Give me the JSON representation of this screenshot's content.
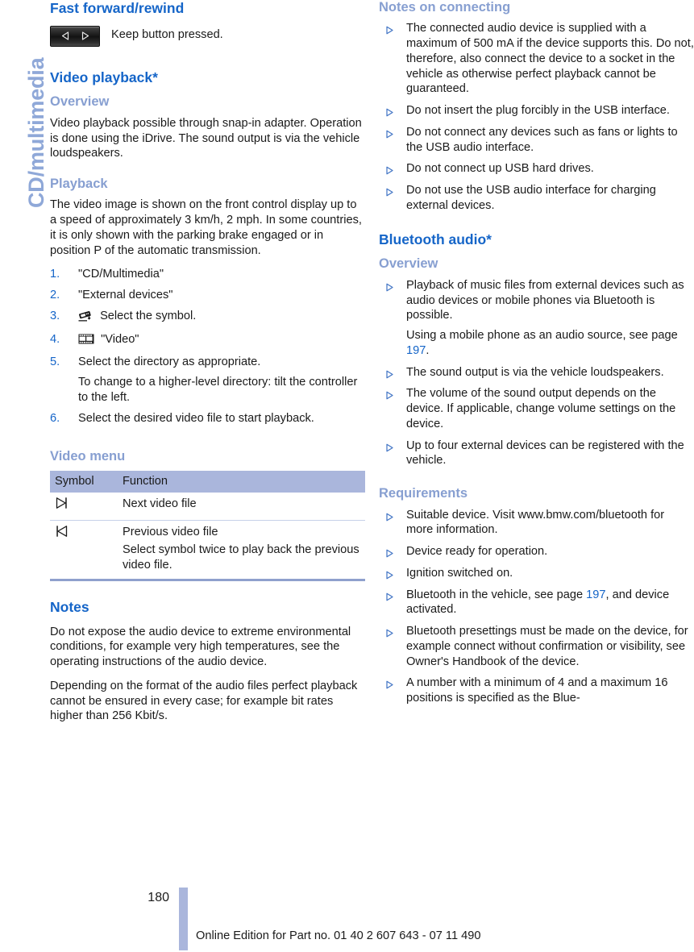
{
  "side_tab": {
    "label": "CD/multimedia"
  },
  "left_column": {
    "fast_forward": {
      "heading": "Fast forward/rewind",
      "button_icon": "seek-back-forward-button",
      "caption": "Keep button pressed."
    },
    "video_playback": {
      "heading": "Video playback*",
      "overview": {
        "heading": "Overview",
        "paragraph": "Video playback possible through snap-in adapter. Operation is done using the iDrive. The sound output is via the vehicle loudspeakers."
      },
      "playback": {
        "heading": "Playback",
        "paragraph": "The video image is shown on the front control display up to a speed of approximately 3 km/h, 2 mph. In some countries, it is only shown with the parking brake engaged or in position P of the automatic transmission.",
        "steps": [
          {
            "num": "1.",
            "icon": null,
            "text": "\"CD/Multimedia\"",
            "note": null
          },
          {
            "num": "2.",
            "icon": null,
            "text": "\"External devices\"",
            "note": null
          },
          {
            "num": "3.",
            "icon": "external-device-icon",
            "text": "Select the symbol.",
            "note": null
          },
          {
            "num": "4.",
            "icon": "filmstrip-icon",
            "text": "\"Video\"",
            "note": null
          },
          {
            "num": "5.",
            "icon": null,
            "text": "Select the directory as appropriate.",
            "note": "To change to a higher-level directory: tilt the controller to the left."
          },
          {
            "num": "6.",
            "icon": null,
            "text": "Select the desired video file to start playback.",
            "note": null
          }
        ]
      },
      "video_menu": {
        "heading": "Video menu",
        "table": {
          "columns": [
            "Symbol",
            "Function"
          ],
          "rows": [
            {
              "symbol_icon": "next-track-icon",
              "function": "Next video file",
              "extra": null
            },
            {
              "symbol_icon": "previous-track-icon",
              "function": "Previous video file",
              "extra": "Select symbol twice to play back the previous video file."
            }
          ]
        }
      }
    },
    "notes": {
      "heading": "Notes",
      "paragraphs": [
        "Do not expose the audio device to extreme environmental conditions, for example very high temperatures, see the operating instructions of the audio device.",
        "Depending on the format of the audio files perfect playback cannot be ensured in every case; for example bit rates higher than 256 Kbit/s."
      ]
    }
  },
  "right_column": {
    "notes_on_connecting": {
      "heading": "Notes on connecting",
      "items": [
        {
          "text": "The connected audio device is supplied with a maximum of 500 mA if the device supports this. Do not, therefore, also connect the device to a socket in the vehicle as otherwise perfect playback cannot be guaranteed.",
          "sub": null
        },
        {
          "text": "Do not insert the plug forcibly in the USB interface.",
          "sub": null
        },
        {
          "text": "Do not connect any devices such as fans or lights to the USB audio interface.",
          "sub": null
        },
        {
          "text": "Do not connect up USB hard drives.",
          "sub": null
        },
        {
          "text": "Do not use the USB audio interface for charging external devices.",
          "sub": null
        }
      ]
    },
    "bluetooth_audio": {
      "heading": "Bluetooth audio*",
      "overview": {
        "heading": "Overview",
        "items": [
          {
            "text": "Playback of music files from external devices such as audio devices or mobile phones via Bluetooth is possible.",
            "sub_before": "Using a mobile phone as an audio source, see page ",
            "sub_link": "197",
            "sub_after": "."
          },
          {
            "text": "The sound output is via the vehicle loudspeakers.",
            "sub_before": null,
            "sub_link": null,
            "sub_after": null
          },
          {
            "text": "The volume of the sound output depends on the device. If applicable, change volume settings on the device.",
            "sub_before": null,
            "sub_link": null,
            "sub_after": null
          },
          {
            "text": "Up to four external devices can be registered with the vehicle.",
            "sub_before": null,
            "sub_link": null,
            "sub_after": null
          }
        ]
      },
      "requirements": {
        "heading": "Requirements",
        "items": [
          {
            "before": "Suitable device. Visit www.bmw.com/bluetooth for more information.",
            "link": null,
            "after": null
          },
          {
            "before": "Device ready for operation.",
            "link": null,
            "after": null
          },
          {
            "before": "Ignition switched on.",
            "link": null,
            "after": null
          },
          {
            "before": "Bluetooth in the vehicle, see page ",
            "link": "197",
            "after": ", and device activated."
          },
          {
            "before": "Bluetooth presettings must be made on the device, for example connect without confirmation or visibility, see Owner's Handbook of the device.",
            "link": null,
            "after": null
          },
          {
            "before": "A number with a minimum of 4 and a maximum 16 positions is specified as the Blue-",
            "link": null,
            "after": null
          }
        ]
      }
    }
  },
  "footer": {
    "page_number": "180",
    "note": "Online Edition for Part no. 01 40 2 607 643 - 07 11 490"
  },
  "colors": {
    "heading_blue": "#1565c8",
    "subheading_blue": "#879fd1",
    "tab_blue": "#8fa8d8",
    "table_header": "#aab6dc",
    "link_blue": "#1565c8"
  }
}
